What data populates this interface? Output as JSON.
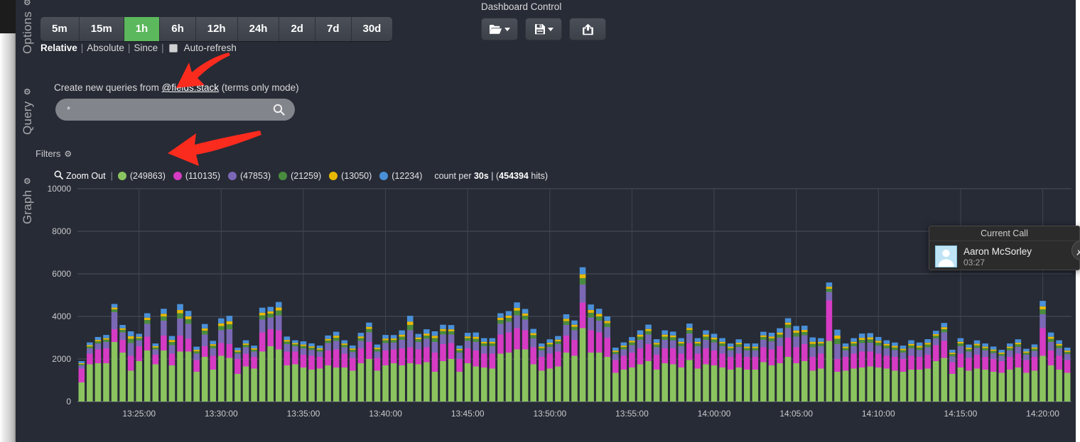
{
  "chrome": {
    "left_strip": "browser-edge",
    "right_strip": "browser-edge"
  },
  "sidebar": {
    "sections": [
      {
        "label": "Options",
        "icon": "gear-icon"
      },
      {
        "label": "Query",
        "icon": "gear-icon"
      },
      {
        "label": "Graph",
        "icon": "gear-icon"
      }
    ]
  },
  "options": {
    "timeranges": [
      {
        "label": "5m",
        "active": false
      },
      {
        "label": "15m",
        "active": false
      },
      {
        "label": "1h",
        "active": true
      },
      {
        "label": "6h",
        "active": false
      },
      {
        "label": "12h",
        "active": false
      },
      {
        "label": "24h",
        "active": false
      },
      {
        "label": "2d",
        "active": false
      },
      {
        "label": "7d",
        "active": false
      },
      {
        "label": "30d",
        "active": false
      }
    ],
    "active_color": "#5cb85c",
    "modes": [
      {
        "label": "Relative",
        "current": true
      },
      {
        "label": "Absolute",
        "current": false
      },
      {
        "label": "Since",
        "current": false
      }
    ],
    "auto_refresh_label": "Auto-refresh",
    "auto_refresh_checked": false,
    "separator": "|"
  },
  "dashboard_control": {
    "title": "Dashboard Control",
    "buttons": [
      {
        "name": "load-dashboard-button",
        "icon": "folder-open-icon",
        "caret": true
      },
      {
        "name": "save-dashboard-button",
        "icon": "floppy-disk-icon",
        "caret": true
      },
      {
        "name": "share-dashboard-button",
        "icon": "share-export-icon",
        "caret": false
      }
    ]
  },
  "query": {
    "prefix_text": "Create new queries from ",
    "field_link": "@fields.stack",
    "suffix_text": " (terms only mode)",
    "input_value": "*",
    "input_placeholder": "*",
    "search_icon": "magnifier-icon"
  },
  "filters": {
    "label": "Filters",
    "icon": "gear-icon"
  },
  "legend": {
    "zoom_out_label": "Zoom Out",
    "zoom_out_icon": "magnifier-minus-icon",
    "separator": "|",
    "series": [
      {
        "color": "#8bc45f",
        "count": "(249863)"
      },
      {
        "color": "#d63bc4",
        "count": "(110135)"
      },
      {
        "color": "#7b68b5",
        "count": "(47853)"
      },
      {
        "color": "#4a8c3f",
        "count": "(21259)"
      },
      {
        "color": "#e8b800",
        "count": "(13050)"
      },
      {
        "color": "#4a90d9",
        "count": "(12234)"
      }
    ],
    "count_prefix": "count per ",
    "interval": "30s",
    "count_sep": " | (",
    "hits": "454394",
    "hits_suffix": " hits)"
  },
  "current_call": {
    "title": "Current Call",
    "caller_name": "Aaron McSorley",
    "duration": "03:27",
    "avatar_icon": "user-avatar-icon",
    "mute_icon": "microphone-muted-icon"
  },
  "annotations": {
    "arrows": [
      {
        "name": "arrow-pointing-at-fields-stack",
        "color": "#fb2b1e"
      },
      {
        "name": "arrow-pointing-at-legend",
        "color": "#fb2b1e"
      }
    ]
  },
  "chart_data": {
    "type": "bar",
    "stacked": true,
    "title": "",
    "xlabel": "",
    "ylabel": "",
    "ylim": [
      0,
      10000
    ],
    "yticks": [
      0,
      2000,
      4000,
      6000,
      8000,
      10000
    ],
    "ytick_labels": [
      "0",
      "2000",
      "4000",
      "6000",
      "8000",
      "10000"
    ],
    "grid": true,
    "legend_position": "top",
    "interval": "30s",
    "total_hits": 454394,
    "xticks": [
      "13:25:00",
      "13:30:00",
      "13:35:00",
      "13:40:00",
      "13:45:00",
      "13:50:00",
      "13:55:00",
      "14:00:00",
      "14:05:00",
      "14:10:00",
      "14:15:00",
      "14:20:00"
    ],
    "xtick_positions": [
      7,
      17,
      27,
      37,
      47,
      57,
      67,
      77,
      87,
      97,
      107,
      117
    ],
    "x_start": "13:21:30",
    "x_end": "14:22:00",
    "series": [
      {
        "name": "series-1",
        "color": "#8bc45f",
        "total": 249863,
        "values": [
          900,
          1750,
          1800,
          1800,
          2800,
          2300,
          1450,
          1900,
          2400,
          1750,
          2400,
          1700,
          2350,
          2350,
          1400,
          2100,
          1500,
          2150,
          2050,
          1300,
          1650,
          1550,
          2350,
          2600,
          2450,
          1700,
          1750,
          1600,
          1500,
          1550,
          1700,
          1600,
          1600,
          1450,
          1800,
          2000,
          1450,
          1700,
          1800,
          1700,
          1800,
          1750,
          1850,
          1400,
          1900,
          2000,
          1400,
          1800,
          1650,
          1600,
          1550,
          2250,
          2300,
          2450,
          2450,
          1750,
          1450,
          1550,
          1650,
          2300,
          2150,
          3450,
          2300,
          2300,
          2100,
          1350,
          1500,
          1600,
          1750,
          1900,
          1500,
          1800,
          1750,
          1600,
          1950,
          1550,
          1750,
          1700,
          1600,
          1500,
          1600,
          1500,
          1500,
          1850,
          1700,
          1800,
          2100,
          1800,
          1900,
          1450,
          1550,
          2850,
          1400,
          1450,
          1550,
          1600,
          1650,
          1600,
          1550,
          1450,
          1400,
          1500,
          1500,
          1550,
          1900,
          2050,
          1300,
          1600,
          1450,
          1550,
          1500,
          1400,
          1350,
          1500,
          1600,
          1350,
          1450,
          2150,
          1700,
          1500,
          1350
        ]
      },
      {
        "name": "series-2",
        "color": "#d63bc4",
        "total": 110135,
        "values": [
          650,
          500,
          650,
          700,
          600,
          600,
          700,
          700,
          650,
          450,
          700,
          550,
          750,
          600,
          550,
          500,
          650,
          600,
          650,
          700,
          600,
          550,
          900,
          800,
          900,
          650,
          600,
          600,
          650,
          550,
          700,
          850,
          650,
          600,
          700,
          800,
          600,
          700,
          650,
          800,
          750,
          700,
          700,
          900,
          800,
          750,
          600,
          700,
          750,
          650,
          700,
          900,
          950,
          1000,
          900,
          800,
          650,
          700,
          700,
          800,
          750,
          1200,
          1050,
          950,
          900,
          600,
          650,
          700,
          750,
          800,
          700,
          700,
          750,
          650,
          800,
          700,
          750,
          700,
          650,
          600,
          650,
          600,
          600,
          700,
          750,
          800,
          900,
          750,
          800,
          650,
          700,
          1900,
          600,
          650,
          700,
          750,
          700,
          650,
          600,
          650,
          600,
          650,
          600,
          650,
          750,
          800,
          550,
          650,
          600,
          650,
          600,
          600,
          550,
          600,
          650,
          600,
          650,
          1300,
          700,
          650,
          600
        ]
      },
      {
        "name": "series-3",
        "color": "#7b68b5",
        "total": 47853,
        "values": [
          150,
          250,
          280,
          300,
          800,
          350,
          600,
          280,
          600,
          250,
          700,
          400,
          800,
          700,
          300,
          550,
          350,
          600,
          700,
          250,
          300,
          250,
          600,
          550,
          700,
          350,
          250,
          300,
          280,
          250,
          350,
          400,
          300,
          280,
          350,
          450,
          300,
          350,
          320,
          400,
          800,
          350,
          400,
          500,
          450,
          400,
          300,
          350,
          400,
          350,
          350,
          500,
          500,
          600,
          500,
          420,
          300,
          320,
          350,
          500,
          450,
          850,
          600,
          550,
          500,
          280,
          300,
          350,
          400,
          450,
          350,
          400,
          380,
          350,
          450,
          350,
          400,
          380,
          350,
          300,
          320,
          300,
          300,
          350,
          380,
          400,
          450,
          500,
          420,
          450,
          350,
          400,
          700,
          300,
          350,
          400,
          420,
          380,
          350,
          320,
          300,
          350,
          320,
          350,
          320,
          400,
          280,
          350,
          300,
          320,
          300,
          280,
          250,
          300,
          320,
          250,
          280,
          650,
          400,
          350,
          280
        ]
      },
      {
        "name": "series-4",
        "color": "#4a8c3f",
        "total": 21259,
        "values": [
          60,
          90,
          100,
          110,
          130,
          120,
          200,
          100,
          180,
          90,
          200,
          150,
          250,
          220,
          110,
          180,
          120,
          200,
          230,
          90,
          110,
          90,
          200,
          180,
          230,
          120,
          90,
          110,
          100,
          90,
          120,
          150,
          110,
          100,
          130,
          160,
          110,
          130,
          120,
          150,
          250,
          130,
          150,
          180,
          160,
          150,
          110,
          130,
          150,
          130,
          130,
          180,
          180,
          220,
          180,
          150,
          110,
          120,
          130,
          180,
          160,
          300,
          220,
          200,
          180,
          100,
          110,
          130,
          150,
          160,
          130,
          150,
          140,
          130,
          160,
          130,
          150,
          140,
          130,
          110,
          120,
          110,
          110,
          130,
          140,
          150,
          160,
          180,
          150,
          160,
          130,
          150,
          250,
          110,
          130,
          150,
          150,
          140,
          130,
          120,
          110,
          130,
          120,
          130,
          120,
          150,
          100,
          130,
          110,
          120,
          110,
          100,
          90,
          110,
          120,
          90,
          100,
          230,
          150,
          130,
          100
        ]
      },
      {
        "name": "series-5",
        "color": "#e8b800",
        "total": 13050,
        "values": [
          40,
          60,
          65,
          70,
          85,
          75,
          120,
          65,
          110,
          60,
          125,
          95,
          150,
          135,
          70,
          110,
          75,
          125,
          140,
          60,
          70,
          60,
          125,
          110,
          140,
          75,
          60,
          70,
          65,
          60,
          75,
          95,
          70,
          65,
          80,
          100,
          70,
          80,
          75,
          95,
          150,
          80,
          95,
          110,
          100,
          95,
          70,
          80,
          95,
          80,
          80,
          110,
          110,
          135,
          110,
          95,
          70,
          75,
          80,
          110,
          100,
          180,
          135,
          125,
          110,
          65,
          70,
          80,
          95,
          100,
          80,
          95,
          85,
          80,
          100,
          80,
          95,
          85,
          80,
          70,
          75,
          70,
          70,
          80,
          85,
          95,
          100,
          110,
          95,
          100,
          80,
          95,
          150,
          70,
          80,
          95,
          95,
          85,
          80,
          75,
          70,
          80,
          75,
          80,
          75,
          95,
          65,
          80,
          70,
          75,
          70,
          65,
          60,
          70,
          75,
          60,
          65,
          140,
          95,
          80,
          65
        ]
      },
      {
        "name": "series-6",
        "color": "#4a90d9",
        "total": 12234,
        "values": [
          100,
          130,
          140,
          150,
          170,
          155,
          230,
          140,
          210,
          130,
          235,
          185,
          280,
          255,
          150,
          205,
          160,
          235,
          260,
          130,
          150,
          130,
          235,
          210,
          260,
          160,
          130,
          150,
          140,
          130,
          160,
          185,
          150,
          140,
          170,
          200,
          150,
          170,
          160,
          200,
          280,
          170,
          200,
          210,
          200,
          200,
          150,
          170,
          200,
          170,
          170,
          210,
          210,
          255,
          210,
          200,
          150,
          160,
          170,
          210,
          200,
          330,
          255,
          235,
          210,
          140,
          150,
          170,
          200,
          205,
          170,
          200,
          180,
          170,
          205,
          170,
          200,
          180,
          170,
          150,
          160,
          150,
          150,
          170,
          180,
          200,
          205,
          210,
          200,
          205,
          170,
          200,
          280,
          150,
          170,
          200,
          200,
          180,
          170,
          160,
          150,
          170,
          160,
          170,
          160,
          200,
          140,
          170,
          150,
          160,
          150,
          140,
          130,
          150,
          160,
          130,
          140,
          260,
          200,
          170,
          140
        ]
      }
    ]
  }
}
